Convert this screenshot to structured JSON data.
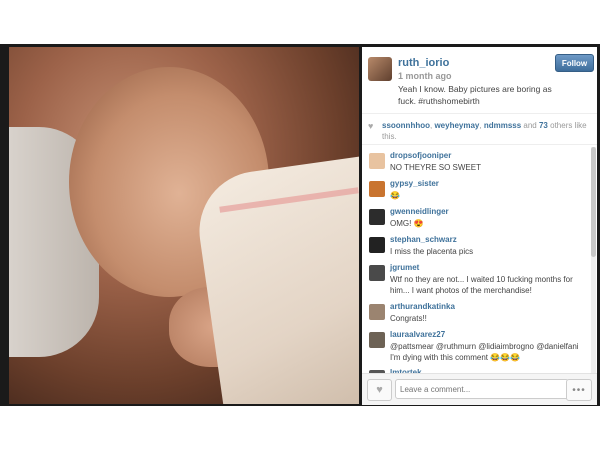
{
  "post": {
    "username": "ruth_iorio",
    "time": "1 month ago",
    "caption": "Yeah I know. Baby pictures are boring as fuck. #ruthshomebirth",
    "follow_label": "Follow"
  },
  "likes": {
    "users": [
      "ssoonnhhoo",
      "weyheymay",
      "ndmmsss"
    ],
    "count": "73",
    "suffix": "others like this."
  },
  "comments": [
    {
      "user": "dropsofjooniper",
      "text": "NO THEYRE SO SWEET",
      "avatar_color": "#e8c3a0"
    },
    {
      "user": "gypsy_sister",
      "text": "😂",
      "avatar_color": "#c9742f"
    },
    {
      "user": "gwenneidlinger",
      "text": "OMG! 😍",
      "avatar_color": "#2c2c2c"
    },
    {
      "user": "stephan_schwarz",
      "text": "I miss the placenta pics",
      "avatar_color": "#222222"
    },
    {
      "user": "jgrumet",
      "text": "Wtf no they are not... I waited 10 fucking months for him... I want photos of the merchandise!",
      "avatar_color": "#4a4a4a"
    },
    {
      "user": "arthurandkatinka",
      "text": "Congrats!!",
      "avatar_color": "#9b8470"
    },
    {
      "user": "lauraalvarez27",
      "text": "@pattsmear @ruthmurn @lidiaimbrogno @danielfani I'm dying with this comment 😂😂😂",
      "avatar_color": "#6d6255"
    },
    {
      "user": "lmtortek",
      "text": "",
      "avatar_color": "#555555"
    }
  ],
  "footer": {
    "comment_placeholder": "Leave a comment...",
    "more_label": "•••"
  },
  "icons": [
    "heart-icon",
    "more-icon"
  ]
}
